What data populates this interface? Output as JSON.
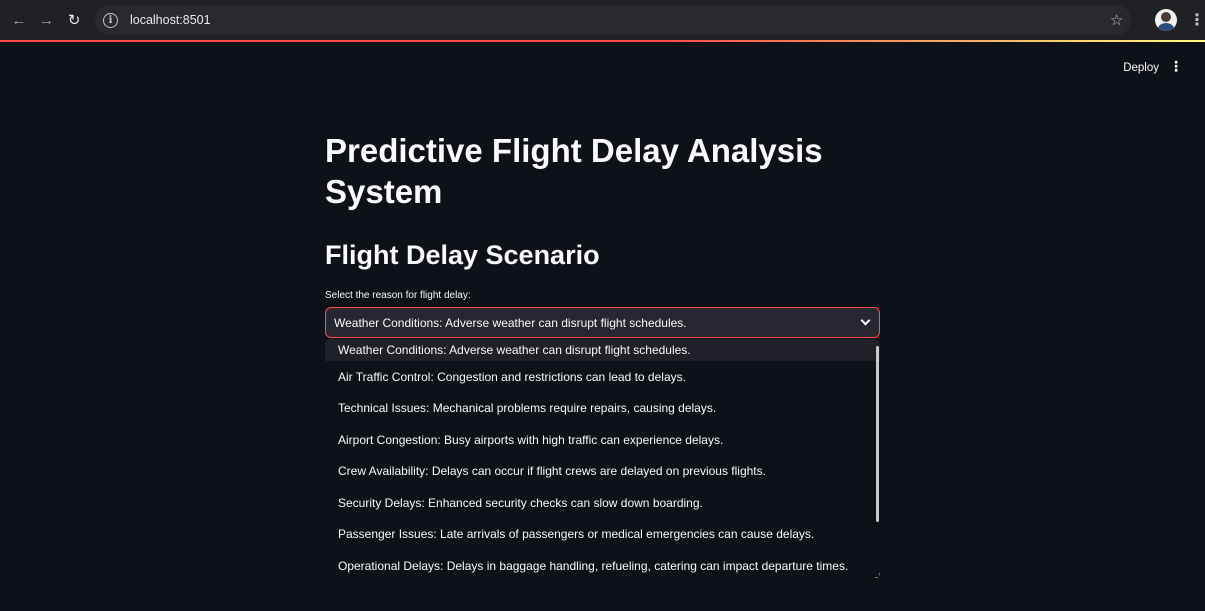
{
  "browser": {
    "url": "localhost:8501",
    "back_icon": "←",
    "forward_icon": "→",
    "reload_icon": "↻",
    "info_icon": "i",
    "star_icon": "☆",
    "menu_icon": "⋮"
  },
  "header": {
    "deploy_label": "Deploy",
    "menu_icon": "⋮"
  },
  "main": {
    "title": "Predictive Flight Delay Analysis System",
    "section_title": "Flight Delay Scenario",
    "select": {
      "label": "Select the reason for flight delay:",
      "value": "Weather Conditions: Adverse weather can disrupt flight schedules.",
      "options": [
        "Weather Conditions: Adverse weather can disrupt flight schedules.",
        "Air Traffic Control: Congestion and restrictions can lead to delays.",
        "Technical Issues: Mechanical problems require repairs, causing delays.",
        "Airport Congestion: Busy airports with high traffic can experience delays.",
        "Crew Availability: Delays can occur if flight crews are delayed on previous flights.",
        "Security Delays: Enhanced security checks can slow down boarding.",
        "Passenger Issues: Late arrivals of passengers or medical emergencies can cause delays.",
        "Operational Delays: Delays in baggage handling, refueling, catering can impact departure times."
      ]
    }
  },
  "colors": {
    "background": "#0e1117",
    "accent": "#ff4b4b",
    "select_bg": "#262730"
  }
}
